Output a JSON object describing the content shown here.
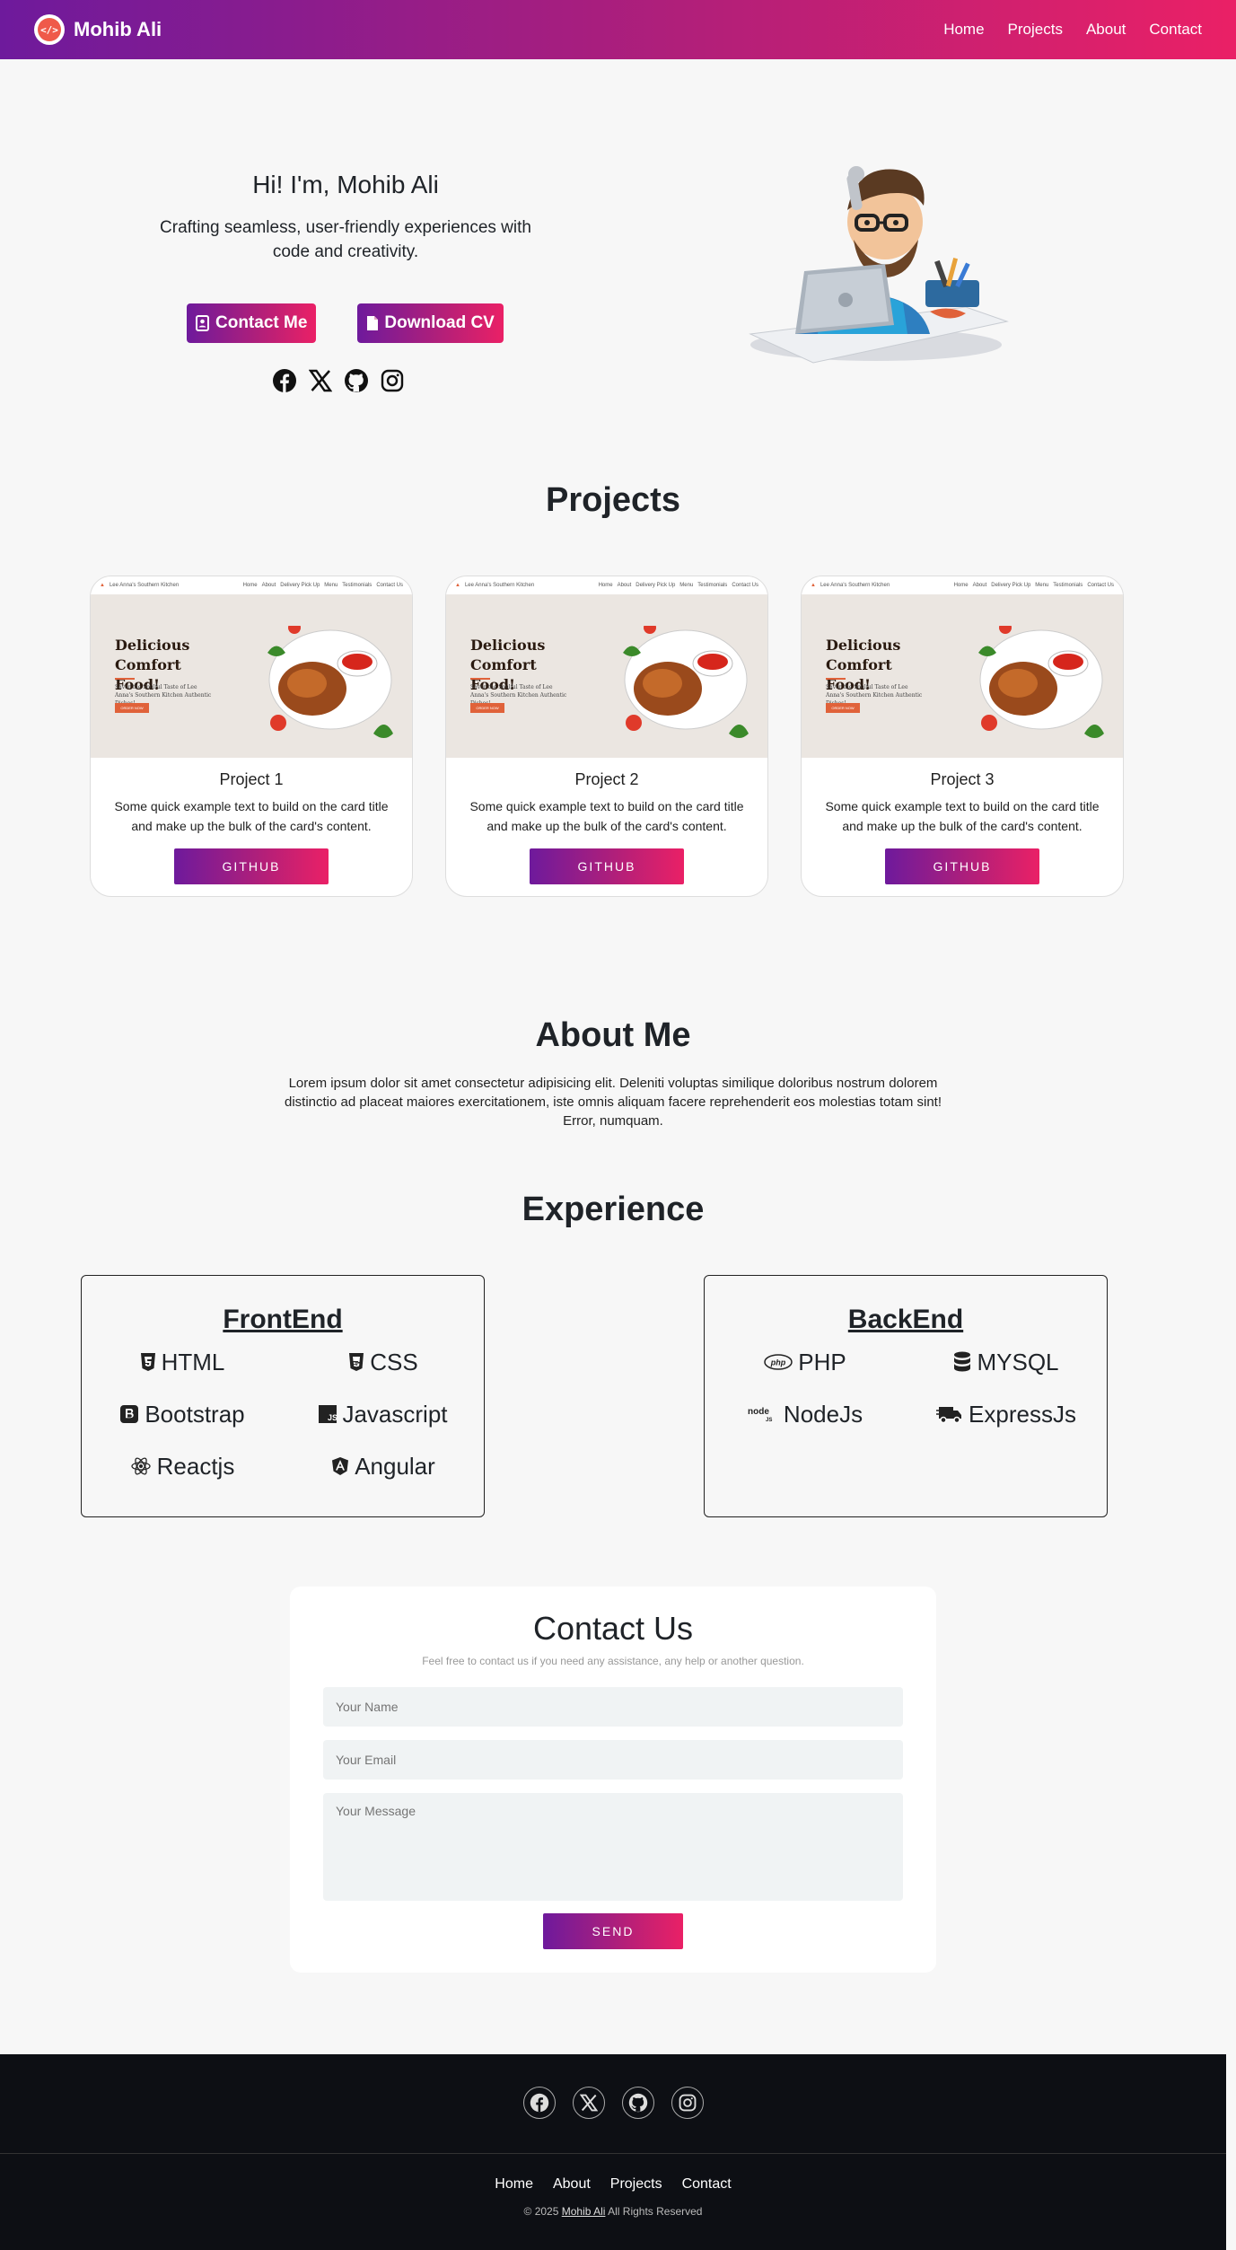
{
  "nav": {
    "brand": "Mohib Ali",
    "logo_text": "</>",
    "links": [
      "Home",
      "Projects",
      "About",
      "Contact"
    ]
  },
  "hero": {
    "title": "Hi! I'm, Mohib Ali",
    "subtitle": "Crafting seamless, user-friendly experiences with code and creativity.",
    "contact_btn": "Contact Me",
    "cv_btn": "Download CV",
    "socials": [
      "facebook-icon",
      "x-icon",
      "github-icon",
      "instagram-icon"
    ]
  },
  "projects": {
    "heading": "Projects",
    "preview": {
      "site_name": "Lee Anna's Southern Kitchen",
      "nav_items": [
        "Home",
        "About",
        "Delivery Pick Up",
        "Menu",
        "Testimonials",
        "Contact Us"
      ],
      "headline": "Delicious Comfort Food!",
      "desc": "Savor the Soulful Taste of Lee Anna's Southern Kitchen Authentic Dishes!",
      "cta": "ORDER NOW"
    },
    "cards": [
      {
        "title": "Project 1",
        "text": "Some quick example text to build on the card title and make up the bulk of the card's content.",
        "button": "GITHUB"
      },
      {
        "title": "Project 2",
        "text": "Some quick example text to build on the card title and make up the bulk of the card's content.",
        "button": "GITHUB"
      },
      {
        "title": "Project 3",
        "text": "Some quick example text to build on the card title and make up the bulk of the card's content.",
        "button": "GITHUB"
      }
    ]
  },
  "about": {
    "heading": "About Me",
    "text": "Lorem ipsum dolor sit amet consectetur adipisicing elit. Deleniti voluptas similique doloribus nostrum dolorem distinctio ad placeat maiores exercitationem, iste omnis aliquam facere reprehenderit eos molestias totam sint! Error, numquam."
  },
  "experience": {
    "heading": "Experience",
    "frontend": {
      "title": "FrontEnd",
      "items": [
        {
          "label": "HTML",
          "icon": "html5-icon"
        },
        {
          "label": "CSS",
          "icon": "css3-icon"
        },
        {
          "label": "Bootstrap",
          "icon": "bootstrap-icon"
        },
        {
          "label": "Javascript",
          "icon": "javascript-icon"
        },
        {
          "label": "Reactjs",
          "icon": "react-icon"
        },
        {
          "label": "Angular",
          "icon": "angular-icon"
        }
      ]
    },
    "backend": {
      "title": "BackEnd",
      "items": [
        {
          "label": "PHP",
          "icon": "php-icon"
        },
        {
          "label": "MYSQL",
          "icon": "database-icon"
        },
        {
          "label": "NodeJs",
          "icon": "nodejs-icon"
        },
        {
          "label": "ExpressJs",
          "icon": "truck-icon"
        }
      ]
    }
  },
  "contact": {
    "title": "Contact Us",
    "subtitle": "Feel free to contact us if you need any assistance, any help or another question.",
    "name_placeholder": "Your Name",
    "email_placeholder": "Your Email",
    "message_placeholder": "Your Message",
    "send": "SEND"
  },
  "footer": {
    "links": [
      "Home",
      "About",
      "Projects",
      "Contact"
    ],
    "copyright_prefix": "© 2025",
    "copyright_name": "Mohib Ali",
    "copyright_suffix": "All Rights Reserved"
  },
  "colors": {
    "gradient_start": "#6e1a9c",
    "gradient_end": "#ea2066",
    "footer_bg": "#0d0f14",
    "page_bg": "#f7f7f7"
  }
}
